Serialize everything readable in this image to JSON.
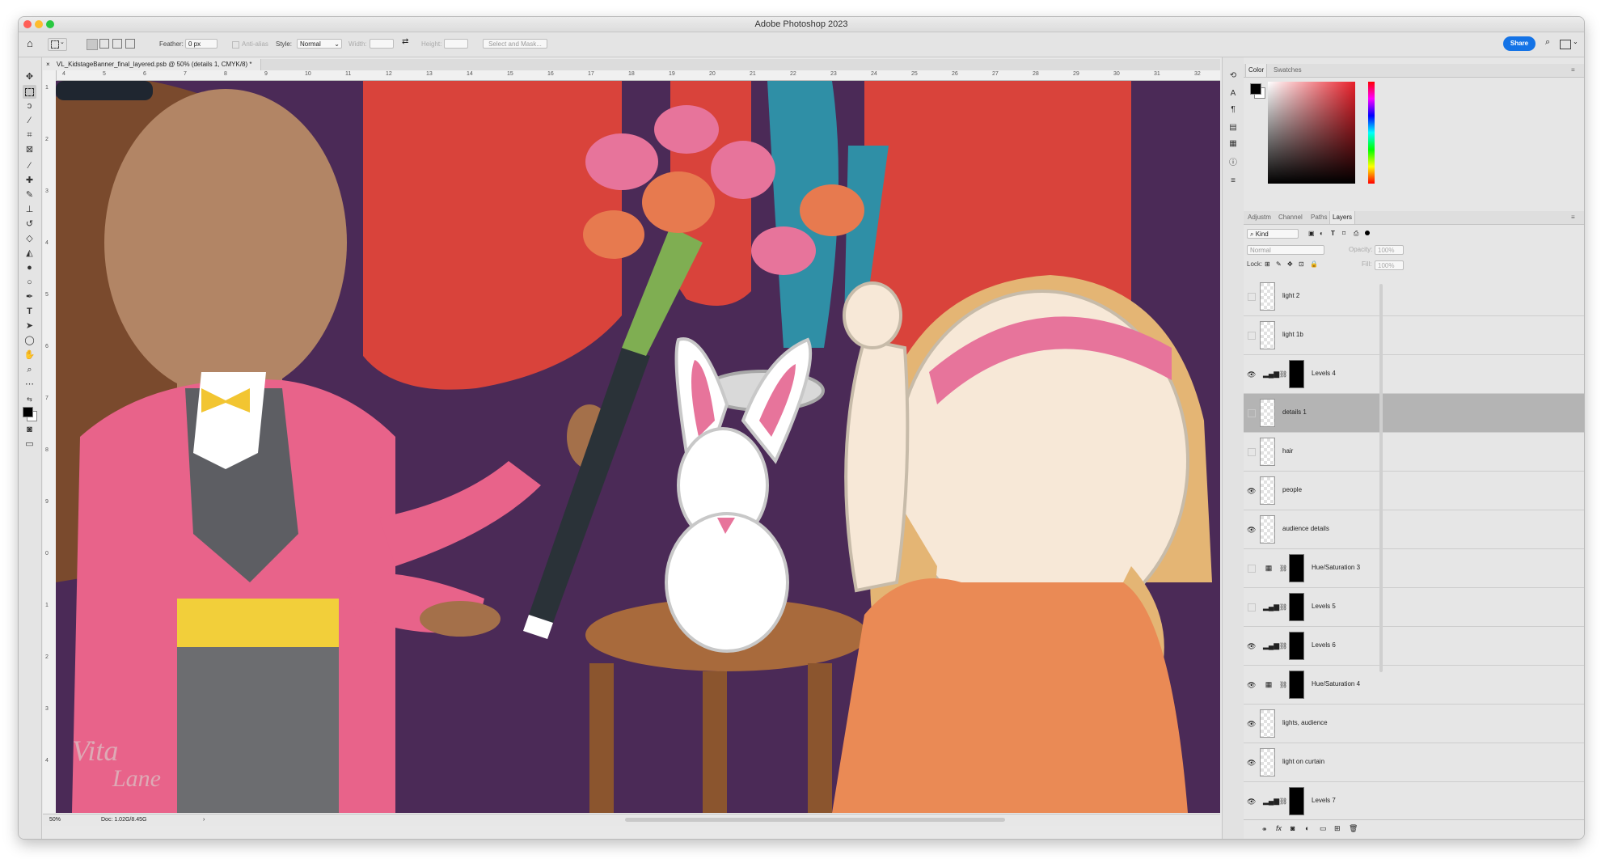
{
  "window": {
    "title": "Adobe Photoshop 2023"
  },
  "options_bar": {
    "feather_label": "Feather:",
    "feather_value": "0 px",
    "antialias_label": "Anti-alias",
    "style_label": "Style:",
    "style_value": "Normal",
    "width_label": "Width:",
    "height_label": "Height:",
    "select_mask_label": "Select and Mask...",
    "share_label": "Share"
  },
  "document": {
    "tab_title": "VL_KidstageBanner_final_layered.psb @ 50% (details 1, CMYK/8) *",
    "zoom": "50%",
    "doc_size": "Doc: 1.02G/8.45G"
  },
  "ruler": {
    "h_ticks": [
      "4",
      "5",
      "6",
      "7",
      "8",
      "9",
      "10",
      "11",
      "12",
      "13",
      "14",
      "15",
      "16",
      "17",
      "18",
      "19",
      "20",
      "21",
      "22",
      "23",
      "24",
      "25",
      "26",
      "27",
      "28",
      "29",
      "30",
      "31",
      "32"
    ],
    "v_ticks": [
      "1",
      "2",
      "3",
      "4",
      "5",
      "6",
      "7",
      "8",
      "9",
      "0",
      "1",
      "2",
      "3",
      "4"
    ]
  },
  "canvas": {
    "watermark_line1": "Vita",
    "watermark_line2": "Lane"
  },
  "color_panel": {
    "tabs": [
      "Color",
      "Swatches"
    ]
  },
  "layers_panel": {
    "tabs": [
      "Adjustm",
      "Channel",
      "Paths",
      "Layers"
    ],
    "filter_label": "Kind",
    "blend_mode": "Normal",
    "opacity_label": "Opacity:",
    "opacity_value": "100%",
    "lock_label": "Lock:",
    "fill_label": "Fill:",
    "fill_value": "100%",
    "layers": [
      {
        "name": "light 2",
        "visible": false,
        "type": "pixel",
        "selected": false
      },
      {
        "name": "light 1b",
        "visible": false,
        "type": "pixel",
        "selected": false
      },
      {
        "name": "Levels 4",
        "visible": true,
        "type": "levels",
        "selected": false
      },
      {
        "name": "details 1",
        "visible": false,
        "type": "pixel",
        "selected": true
      },
      {
        "name": "hair",
        "visible": false,
        "type": "pixel",
        "selected": false
      },
      {
        "name": "people",
        "visible": true,
        "type": "pixel",
        "selected": false
      },
      {
        "name": "audience details",
        "visible": true,
        "type": "pixel",
        "selected": false
      },
      {
        "name": "Hue/Saturation 3",
        "visible": false,
        "type": "huesat",
        "selected": false
      },
      {
        "name": "Levels 5",
        "visible": false,
        "type": "levels",
        "selected": false
      },
      {
        "name": "Levels 6",
        "visible": true,
        "type": "levels",
        "selected": false
      },
      {
        "name": "Hue/Saturation 4",
        "visible": true,
        "type": "huesat",
        "selected": false
      },
      {
        "name": "lights, audience",
        "visible": true,
        "type": "pixel",
        "selected": false
      },
      {
        "name": "light on curtain",
        "visible": true,
        "type": "pixel",
        "selected": false
      },
      {
        "name": "Levels 7",
        "visible": true,
        "type": "levels",
        "selected": false
      }
    ]
  },
  "tool_icons": [
    "move-icon",
    "marquee-icon",
    "lasso-icon",
    "magic-wand-icon",
    "crop-icon",
    "frame-icon",
    "eyedropper-icon",
    "healing-brush-icon",
    "brush-icon",
    "clone-stamp-icon",
    "history-brush-icon",
    "eraser-icon",
    "paint-bucket-icon",
    "blur-icon",
    "dodge-icon",
    "pen-icon",
    "type-icon",
    "path-selection-icon",
    "ellipse-icon",
    "hand-icon",
    "zoom-icon",
    "more-tools-icon",
    "swap-colors-icon",
    "foreground-color-icon",
    "quick-mask-icon",
    "screen-mode-icon"
  ]
}
